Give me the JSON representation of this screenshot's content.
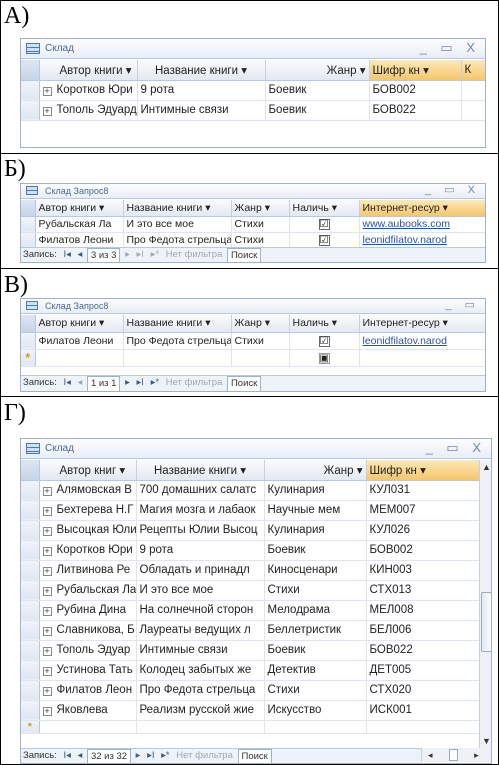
{
  "labels": {
    "a": "А)",
    "b": "Б)",
    "v": "В)",
    "g": "Г)"
  },
  "colors": {
    "header": "#e3e9f2",
    "highlight_header": "#f6c669",
    "link": "#2a4fb0",
    "border": "#9db2cf"
  },
  "panel_a": {
    "title": "Склад",
    "window_controls": "_ ▭ X",
    "headers": [
      "Автор книги ▾",
      "Название книги ▾",
      "Жанр ▾",
      "Шифр кн ▾",
      "К"
    ],
    "rows": [
      [
        "Коротков Юри",
        "9 рота",
        "Боевик",
        "БОВ002"
      ],
      [
        "Тополь Эдуард",
        "Интимные связи",
        "Боевик",
        "БОВ022"
      ]
    ]
  },
  "panel_b": {
    "title": "Склад Запрос8",
    "window_controls": "_ ▭ X",
    "headers": [
      "Автор книги ▾",
      "Название книги ▾",
      "Жанр ▾",
      "Наличь ▾",
      "Интернет-ресур ▾"
    ],
    "rows": [
      [
        "Рубальская Ла",
        "И это все мое",
        "Стихи",
        "☑",
        "www.aubooks.com"
      ],
      [
        "Филатов Леони",
        "Про Федота стрельца",
        "Стихи",
        "☑",
        "leonidfilatov.narod"
      ]
    ],
    "new_row_marker": "*",
    "new_row_check": "▣",
    "nav": {
      "label": "Запись:",
      "first": "I◂",
      "prev": "◂",
      "record": "3 из 3",
      "next": "▸",
      "last": "▸I",
      "new": "▸*",
      "filter": "Нет фильтра",
      "search": "Поиск"
    }
  },
  "panel_v": {
    "title": "Склад Запрос8",
    "window_controls": "_ ▭",
    "headers": [
      "Автор книги ▾",
      "Название книги ▾",
      "Жанр ▾",
      "Наличь ▾",
      "Интернет-ресур ▾"
    ],
    "rows": [
      [
        "Филатов Леони",
        "Про Федота стрельца",
        "Стихи",
        "☑",
        "leonidfilatov.narod"
      ]
    ],
    "new_row_marker": "*",
    "new_row_check": "▣",
    "nav": {
      "label": "Запись:",
      "first": "I◂",
      "prev": "◂",
      "record": "1 из 1",
      "next": "▸",
      "last": "▸I",
      "new": "▸*",
      "filter": "Нет фильтра",
      "search": "Поиск"
    }
  },
  "panel_g": {
    "title": "Склад",
    "window_controls": "_ ▭ X",
    "headers": [
      "Автор книг ▾",
      "Название книги ▾",
      "Жанр ▾",
      "Шифр кн ▾"
    ],
    "rows": [
      [
        "Алямовская В",
        "700 домашних салатс",
        "Кулинария",
        "КУЛ031"
      ],
      [
        "Бехтерева Н.Г",
        "Магия мозга и лабаок",
        "Научные мем",
        "МЕМ007"
      ],
      [
        "Высоцкая Юли",
        "Рецепты Юлии Высоц",
        "Кулинария",
        "КУЛ026"
      ],
      [
        "Коротков Юри",
        "9 рота",
        "Боевик",
        "БОВ002"
      ],
      [
        "Литвинова Ре",
        "Обладать и принадл",
        "Киносценари",
        "КИН003"
      ],
      [
        "Рубальская Ла",
        "И это все мое",
        "Стихи",
        "СТХ013"
      ],
      [
        "Рубина Дина",
        "На солнечной сторон",
        "Мелодрама",
        "МЕЛ008"
      ],
      [
        "Славникова, Б",
        "Лауреаты ведущих л",
        "Беллетристик",
        "БЕЛ006"
      ],
      [
        "Тополь Эдуар",
        "Интимные связи",
        "Боевик",
        "БОВ022"
      ],
      [
        "Устинова Тать",
        "Колодец забытых же",
        "Детектив",
        "ДЕТ005"
      ],
      [
        "Филатов Леон",
        "Про Федота стрельца",
        "Стихи",
        "СТХ020"
      ],
      [
        "Яковлева",
        "Реализм русской жие",
        "Искусство",
        "ИСК001"
      ]
    ],
    "new_row_marker": "*",
    "nav": {
      "label": "Запись:",
      "first": "I◂",
      "prev": "◂",
      "record": "32 из 32",
      "next": "▸",
      "last": "▸I",
      "new": "▸*",
      "filter": "Нет фильтра",
      "search": "Поиск"
    }
  }
}
